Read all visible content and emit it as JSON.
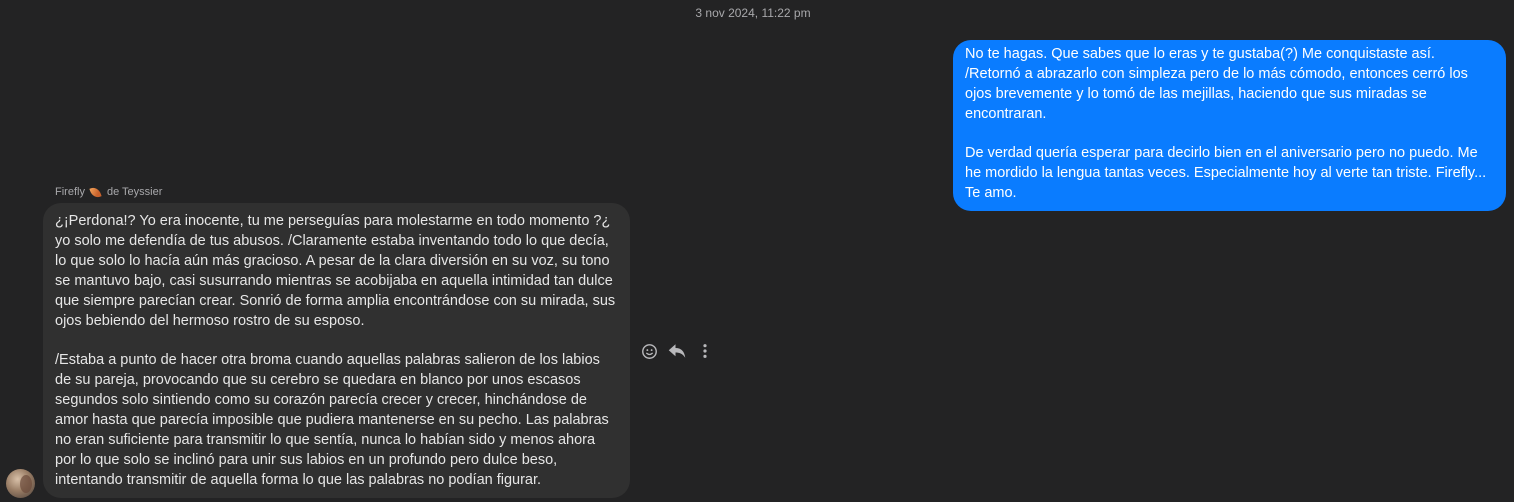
{
  "conversation": {
    "timestamp": "3 nov 2024, 11:22 pm"
  },
  "outgoing_message": {
    "paragraphs": [
      "No te hagas. Que sabes que lo eras y te gustaba(?) Me conquistaste así. /Retornó a abrazarlo con simpleza pero de lo más cómodo, entonces cerró los ojos brevemente y lo tomó de las mejillas, haciendo que sus miradas se encontraran.",
      "De verdad quería esperar para decirlo bien en el aniversario pero no puedo. Me he mordido la lengua tantas veces. Especialmente hoy al verte tan triste. Firefly... Te amo."
    ]
  },
  "incoming_message": {
    "sender_first": "Firefly",
    "sender_icon": "flame-emoji-icon",
    "sender_rest": "de Teyssier",
    "paragraphs": [
      "¿¡Perdona!? Yo era inocente, tu me perseguías para molestarme en todo momento ?¿ yo solo me defendía de tus abusos. /Claramente estaba inventando todo lo que decía, lo que solo lo hacía aún más gracioso. A pesar de la clara diversión en su voz, su tono se mantuvo bajo, casi susurrando mientras se acobijaba en aquella intimidad tan dulce que siempre parecían crear. Sonrió de forma amplia encontrándose con su mirada, sus ojos bebiendo del hermoso rostro de su esposo.",
      "/Estaba a punto de hacer otra broma cuando aquellas palabras salieron de los labios de su pareja, provocando que su cerebro se quedara en blanco por unos escasos segundos solo sintiendo como su corazón parecía crecer y crecer, hinchándose de amor hasta que parecía imposible que pudiera mantenerse en su pecho. Las palabras no eran suficiente para transmitir lo que sentía, nunca lo habían sido y menos ahora por lo que solo se inclinó para unir sus labios en un profundo pero dulce beso, intentando transmitir de aquella forma lo que las palabras no podían figurar."
    ]
  },
  "message_actions": [
    {
      "icon": "smiley-react-icon"
    },
    {
      "icon": "reply-icon"
    },
    {
      "icon": "more-options-icon"
    }
  ],
  "colors": {
    "background": "#232324",
    "outgoing_bubble": "#0a7cff",
    "incoming_bubble": "#303030",
    "secondary_text": "#a8a8ab"
  }
}
